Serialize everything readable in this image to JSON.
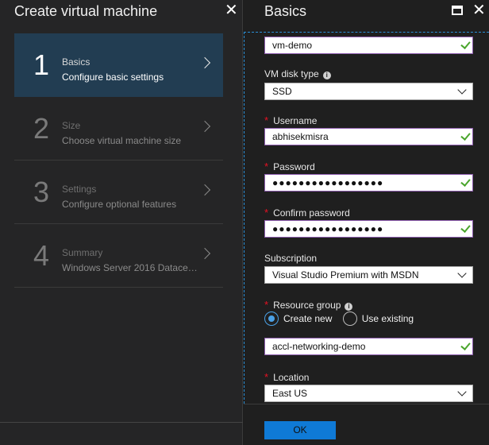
{
  "left_blade": {
    "title": "Create virtual machine",
    "close_glyph": "✕",
    "steps": [
      {
        "number": "1",
        "title": "Basics",
        "subtitle": "Configure basic settings",
        "active": true
      },
      {
        "number": "2",
        "title": "Size",
        "subtitle": "Choose virtual machine size",
        "active": false
      },
      {
        "number": "3",
        "title": "Settings",
        "subtitle": "Configure optional features",
        "active": false
      },
      {
        "number": "4",
        "title": "Summary",
        "subtitle": "Windows Server 2016 Datacen...",
        "active": false
      }
    ]
  },
  "right_blade": {
    "title": "Basics",
    "close_glyph": "✕",
    "info_glyph": "i",
    "name_value": "vm-demo",
    "disk_type": {
      "label": "VM disk type",
      "value": "SSD"
    },
    "username": {
      "label": "Username",
      "value": "abhisekmisra"
    },
    "password": {
      "label": "Password",
      "value": "●●●●●●●●●●●●●●●●●"
    },
    "confirm_password": {
      "label": "Confirm password",
      "value": "●●●●●●●●●●●●●●●●●"
    },
    "subscription": {
      "label": "Subscription",
      "value": "Visual Studio Premium with MSDN"
    },
    "resource_group": {
      "label": "Resource group",
      "option_new": "Create new",
      "option_existing": "Use existing",
      "value": "accl-networking-demo"
    },
    "location": {
      "label": "Location",
      "value": "East US"
    },
    "required_mark": "*",
    "ok_label": "OK"
  },
  "colors": {
    "active_step_bg": "#223d52",
    "input_border": "#8f5fb0",
    "check": "#4aa52c",
    "radio_accent": "#4ba1e6",
    "ok_button": "#0f7ad6",
    "required": "#e81123"
  },
  "icons": [
    "close-icon",
    "chevron-right-icon",
    "maximize-icon",
    "info-icon",
    "check-icon",
    "dropdown-caret-icon"
  ]
}
